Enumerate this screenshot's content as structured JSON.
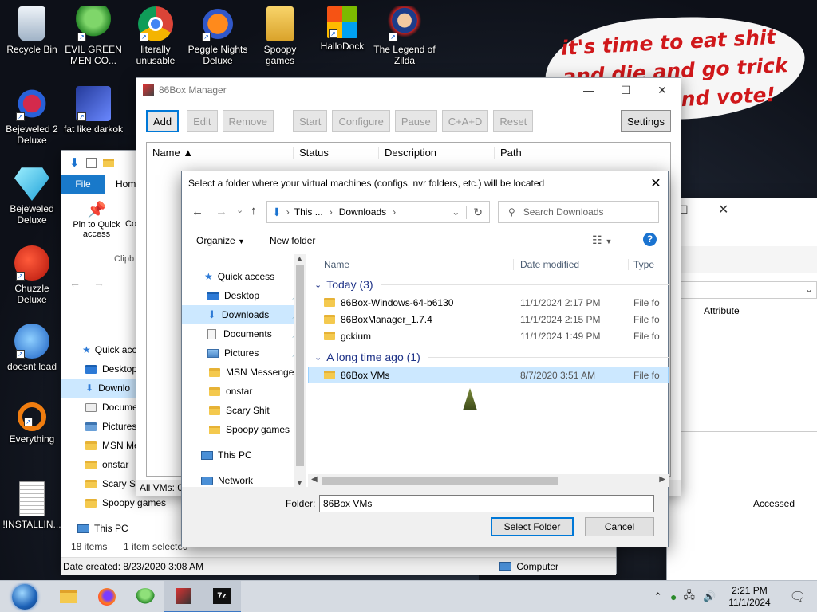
{
  "desktop": {
    "icons": [
      {
        "label": "Recycle Bin"
      },
      {
        "label": "EVIL GREEN MEN CO..."
      },
      {
        "label": "literally unusable"
      },
      {
        "label": "Peggle Nights Deluxe"
      },
      {
        "label": "Spoopy games"
      },
      {
        "label": "HalloDock"
      },
      {
        "label": "The Legend of Zilda"
      },
      {
        "label": "Bejeweled 2 Deluxe"
      },
      {
        "label": "fat like darkok"
      },
      {
        "label": "Bejeweled Deluxe"
      },
      {
        "label": "Chuzzle Deluxe"
      },
      {
        "label": "doesnt load"
      },
      {
        "label": "Everything"
      },
      {
        "label": "!INSTALLIN..."
      }
    ],
    "bubble_line1": "it's time to eat shit",
    "bubble_line2": "and die and go trick",
    "bubble_line3": "and vote!"
  },
  "manager": {
    "title": "86Box Manager",
    "buttons": {
      "add": "Add",
      "edit": "Edit",
      "remove": "Remove",
      "start": "Start",
      "configure": "Configure",
      "pause": "Pause",
      "cad": "C+A+D",
      "reset": "Reset",
      "settings": "Settings"
    },
    "columns": {
      "name": "Name ▲",
      "status": "Status",
      "description": "Description",
      "path": "Path"
    },
    "status_text": "All VMs: 0"
  },
  "explorer": {
    "tab_file": "File",
    "tab_home": "Hom",
    "pin_label": "Pin to Quick access",
    "co_label": "Co",
    "clipboard": "Clipb",
    "nav": [
      "Quick acc",
      "Desktop",
      "Downlo",
      "Docume",
      "Pictures",
      "MSN Mes",
      "onstar",
      "Scary Sh",
      "Spoopy games",
      "This PC"
    ],
    "items_count": "18 items",
    "selected_count": "1 item selected",
    "date_created": "Date created: 8/23/2020 3:08 AM",
    "computer": "Computer",
    "attributes": "Attribute",
    "accessed": "Accessed"
  },
  "dialog": {
    "title": "Select a folder where your virtual machines (configs, nvr folders, etc.) will be located",
    "address": {
      "this": "This ...",
      "downloads": "Downloads"
    },
    "search_placeholder": "Search Downloads",
    "organize": "Organize",
    "new_folder": "New folder",
    "nav": [
      {
        "label": "Quick access"
      },
      {
        "label": "Desktop"
      },
      {
        "label": "Downloads"
      },
      {
        "label": "Documents"
      },
      {
        "label": "Pictures"
      },
      {
        "label": "MSN Messenger"
      },
      {
        "label": "onstar"
      },
      {
        "label": "Scary Shit"
      },
      {
        "label": "Spoopy games"
      },
      {
        "label": "This PC"
      },
      {
        "label": "Network"
      }
    ],
    "columns": {
      "name": "Name",
      "date": "Date modified",
      "type": "Type"
    },
    "groups": [
      {
        "label": "Today (3)",
        "rows": [
          {
            "name": "86Box-Windows-64-b6130",
            "date": "11/1/2024 2:17 PM",
            "type": "File fo"
          },
          {
            "name": "86BoxManager_1.7.4",
            "date": "11/1/2024 2:15 PM",
            "type": "File fo"
          },
          {
            "name": "gckium",
            "date": "11/1/2024 1:49 PM",
            "type": "File fo"
          }
        ]
      },
      {
        "label": "A long time ago (1)",
        "rows": [
          {
            "name": "86Box VMs",
            "date": "8/7/2020 3:51 AM",
            "type": "File fo"
          }
        ]
      }
    ],
    "folder_label": "Folder:",
    "folder_value": "86Box VMs",
    "select_button": "Select Folder",
    "cancel_button": "Cancel"
  },
  "taskbar": {
    "time": "2:21 PM",
    "date": "11/1/2024"
  }
}
